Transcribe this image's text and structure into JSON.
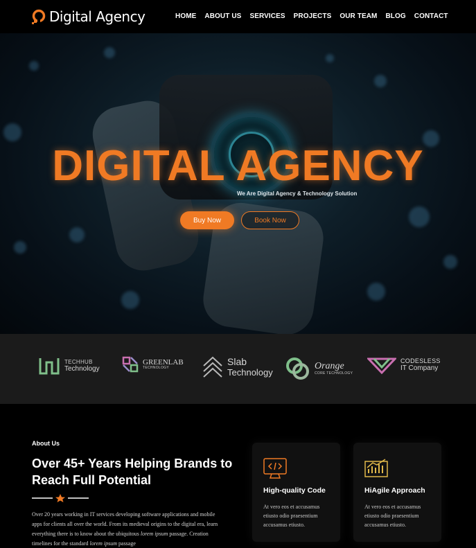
{
  "header": {
    "brand": "Digital Agency",
    "nav": [
      "HOME",
      "ABOUT US",
      "SERVICES",
      "PROJECTS",
      "OUR TEAM",
      "BLOG",
      "CONTACT"
    ]
  },
  "hero": {
    "title": "DIGITAL AGENCY",
    "subtitle": "We Are Digital Agency & Technology Solution",
    "buy_label": "Buy Now",
    "book_label": "Book Now"
  },
  "partners": [
    {
      "small": "TECHHUB",
      "big": "Technology"
    },
    {
      "small": "TECHNOLOGY",
      "big": "GREENLAB"
    },
    {
      "small": "Slab",
      "big": "Technology"
    },
    {
      "small": "CORE TECHNOLOGY",
      "big": "Orange"
    },
    {
      "small": "CODESLESS",
      "big": "IT Company"
    }
  ],
  "about": {
    "kicker": "About Us",
    "title": "Over 45+ Years Helping Brands to Reach Full Potential",
    "body_1": "Over 20 years working in IT services developing software applications and mobile apps for clients all over the world. From its medieval origins to the digital era, learn everything there is to know about the ubiquitous",
    "body_em_1": "lorem ipsum",
    "body_2": "passage. Creation timelines for the standard",
    "body_em_2": "lorem ipsum",
    "body_3": "passage"
  },
  "cards": [
    {
      "title": "High-quality Code",
      "text": "At vero eos et accusamus etiusto odio praesentium accusamus etiusto.",
      "icon": "code-icon"
    },
    {
      "title": "HiAgile Approach",
      "text": "At vero eos et accusamus etiusto odio praesentium accusamus etiusto.",
      "icon": "chart-icon"
    }
  ],
  "colors": {
    "accent": "#f07a24",
    "background": "#000000",
    "partner_band": "#1b1b1b"
  }
}
